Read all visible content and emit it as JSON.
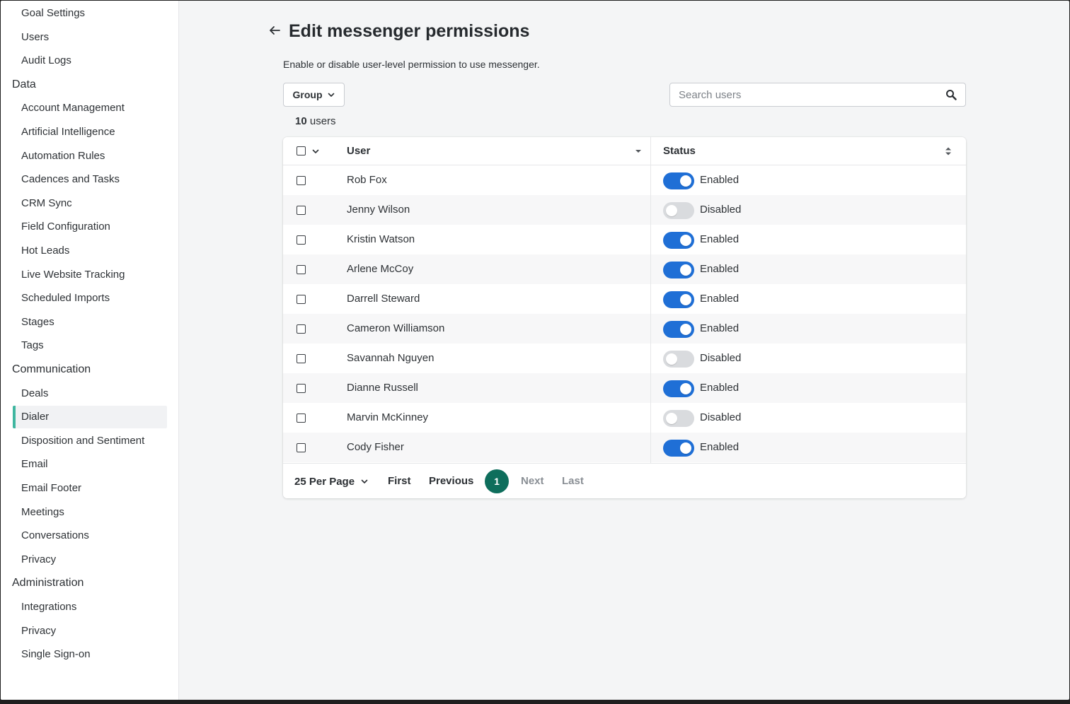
{
  "sidebar": {
    "top_items": [
      {
        "label": "Goal Settings"
      },
      {
        "label": "Users"
      },
      {
        "label": "Audit Logs"
      }
    ],
    "sections": [
      {
        "title": "Data",
        "items": [
          {
            "label": "Account Management"
          },
          {
            "label": "Artificial Intelligence"
          },
          {
            "label": "Automation Rules"
          },
          {
            "label": "Cadences and Tasks"
          },
          {
            "label": "CRM Sync"
          },
          {
            "label": "Field Configuration"
          },
          {
            "label": "Hot Leads"
          },
          {
            "label": "Live Website Tracking"
          },
          {
            "label": "Scheduled Imports"
          },
          {
            "label": "Stages"
          },
          {
            "label": "Tags"
          }
        ]
      },
      {
        "title": "Communication",
        "items": [
          {
            "label": "Deals"
          },
          {
            "label": "Dialer",
            "active": true
          },
          {
            "label": "Disposition and Sentiment"
          },
          {
            "label": "Email"
          },
          {
            "label": "Email Footer"
          },
          {
            "label": "Meetings"
          },
          {
            "label": "Conversations"
          },
          {
            "label": "Privacy"
          }
        ]
      },
      {
        "title": "Administration",
        "items": [
          {
            "label": "Integrations"
          },
          {
            "label": "Privacy"
          },
          {
            "label": "Single Sign-on"
          }
        ]
      }
    ],
    "active_color": "#3fb6a0"
  },
  "header": {
    "title": "Edit messenger permissions",
    "description": "Enable or disable user-level permission to use messenger."
  },
  "toolbar": {
    "group_label": "Group",
    "search_placeholder": "Search users"
  },
  "summary": {
    "count": "10",
    "unit": "users"
  },
  "table": {
    "columns": {
      "user": "User",
      "status": "Status"
    },
    "rows": [
      {
        "name": "Rob Fox",
        "enabled": true,
        "status": "Enabled"
      },
      {
        "name": "Jenny Wilson",
        "enabled": false,
        "status": "Disabled"
      },
      {
        "name": "Kristin Watson",
        "enabled": true,
        "status": "Enabled"
      },
      {
        "name": "Arlene McCoy",
        "enabled": true,
        "status": "Enabled"
      },
      {
        "name": "Darrell Steward",
        "enabled": true,
        "status": "Enabled"
      },
      {
        "name": "Cameron Williamson",
        "enabled": true,
        "status": "Enabled"
      },
      {
        "name": "Savannah Nguyen",
        "enabled": false,
        "status": "Disabled"
      },
      {
        "name": "Dianne Russell",
        "enabled": true,
        "status": "Enabled"
      },
      {
        "name": "Marvin McKinney",
        "enabled": false,
        "status": "Disabled"
      },
      {
        "name": "Cody Fisher",
        "enabled": true,
        "status": "Enabled"
      }
    ],
    "toggle_on_color": "#1f6fd6",
    "toggle_off_color": "#d9dbde"
  },
  "pagination": {
    "per_page_label": "25 Per Page",
    "first": "First",
    "previous": "Previous",
    "current_page": "1",
    "next": "Next",
    "last": "Last",
    "current_color": "#0e6e5c"
  }
}
